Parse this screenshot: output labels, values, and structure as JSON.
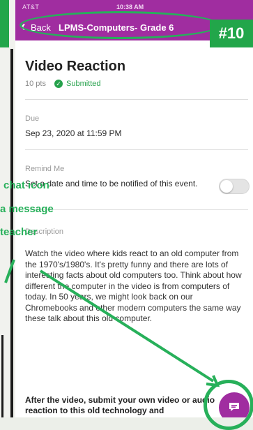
{
  "status_bar": {
    "carrier": "AT&T",
    "time": "10:38 AM"
  },
  "nav": {
    "back_label": "Back",
    "course_title": "LPMS-Computers- Grade 6"
  },
  "slide_badge": "#10",
  "assignment": {
    "title": "Video Reaction",
    "points": "10 pts",
    "status": "Submitted",
    "due_label": "Due",
    "due_value": "Sep 23, 2020 at 11:59 PM",
    "remind_label": "Remind Me",
    "remind_text": "Set a date and time to be notified of this event.",
    "description_label": "Description",
    "description": "Watch the video where kids react to an old computer from the 1970's/1980's. It's pretty funny and there are lots of interesting facts about old computers too. Think about how different the computer in the video is from computers of today. In 50 years, we might look back on our Chromebooks and other modern computers the same way these talk about this old computer.",
    "after_text": "After the video, submit your own video or audio reaction to this old technology and"
  },
  "annotation": {
    "line1": "chat icon",
    "line2": "a message",
    "line3": "teacher"
  },
  "colors": {
    "brand": "#a02da0",
    "annotation": "#27b05a",
    "status_ok": "#25a14b"
  },
  "icons": {
    "back": "chevron-left-icon",
    "check": "check-circle-icon",
    "chat": "chat-bubble-icon"
  }
}
